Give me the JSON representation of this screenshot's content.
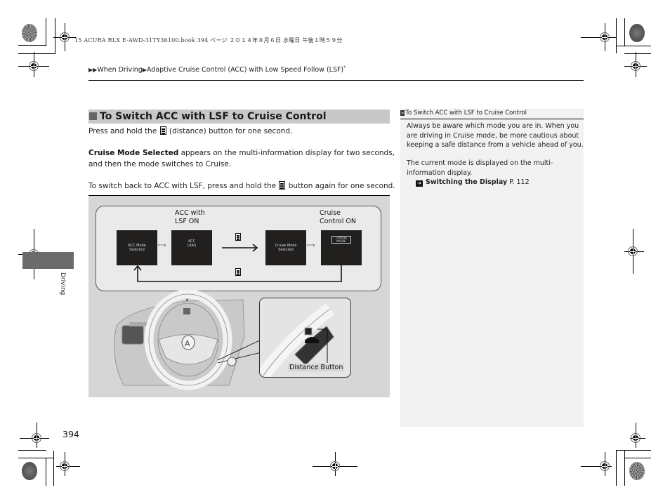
{
  "print_job_line": "15 ACURA RLX E-AWD-31TY36100.book  394 ページ  ２０１４年８月６日  水曜日  午後１時５９分",
  "breadcrumb": {
    "items": [
      "When Driving",
      "Adaptive Cruise Control (ACC) with Low Speed Follow (LSF)"
    ],
    "suffix": "*"
  },
  "section": {
    "title": "To Switch ACC with LSF to Cruise Control",
    "para1_before": "Press and hold the",
    "para1_after": "(distance) button for one second.",
    "para2_bold": "Cruise Mode Selected",
    "para2_rest_line1": " appears on the multi-information display for two seconds,",
    "para2_line2": "and then the mode switches to Cruise.",
    "para3_before": "To switch back to ACC with LSF, press and hold the",
    "para3_after": "button again for one second."
  },
  "figure": {
    "label_acc": "ACC with\nLSF ON",
    "label_cruise": "Cruise\nControl ON",
    "screens": [
      {
        "text": "ACC Mode\nSelected"
      },
      {
        "text": "ACC\nLKAS"
      },
      {
        "text": "Cruise Mode\nSelected"
      },
      {
        "text": "",
        "badge": "CRUISE\nMODE"
      }
    ],
    "callout": "Distance Button",
    "dotted_arrow": "·····›"
  },
  "sidebar": {
    "title": "To Switch ACC with LSF to Cruise Control",
    "para1": [
      "Always be aware which mode you are in. When you",
      "are driving in Cruise mode, be more cautious about",
      "keeping a safe distance from a vehicle ahead of you."
    ],
    "para2": [
      "The current mode is displayed on the multi-",
      "information display."
    ],
    "xref_title": "Switching the Display",
    "xref_page": "P. 112"
  },
  "side_tab": {
    "label": "Driving"
  },
  "page_number": "394"
}
